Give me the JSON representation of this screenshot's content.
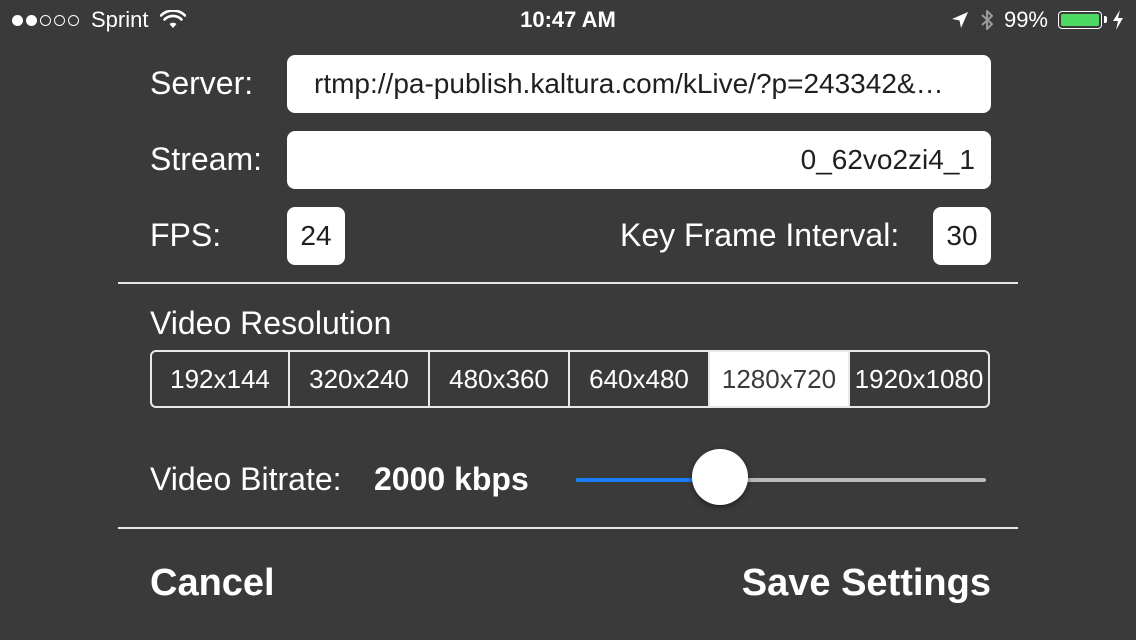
{
  "status_bar": {
    "carrier": "Sprint",
    "time": "10:47 AM",
    "battery": "99%",
    "battery_level": 0.99,
    "signal_bars": 2,
    "signal_total": 5,
    "icons": [
      "wifi-icon",
      "location-arrow-icon",
      "bluetooth-icon",
      "battery-icon",
      "charging-bolt-icon"
    ],
    "battery_color": "#4cd964"
  },
  "form": {
    "server_label": "Server:",
    "server_value": "rtmp://pa-publish.kaltura.com/kLive/?p=243342&…",
    "stream_label": "Stream:",
    "stream_value": "0_62vo2zi4_1",
    "fps_label": "FPS:",
    "fps_value": "24",
    "keyframe_label": "Key Frame Interval:",
    "keyframe_value": "30"
  },
  "resolution": {
    "label": "Video Resolution",
    "options": [
      "192x144",
      "320x240",
      "480x360",
      "640x480",
      "1280x720",
      "1920x1080"
    ],
    "selected_index": 4
  },
  "bitrate": {
    "label": "Video Bitrate:",
    "value": "2000 kbps",
    "slider_fraction": 0.35,
    "track_color": "#1a7cf5"
  },
  "actions": {
    "cancel": "Cancel",
    "save": "Save Settings"
  },
  "colors": {
    "background": "#3a3a3a",
    "field": "#ffffff"
  }
}
